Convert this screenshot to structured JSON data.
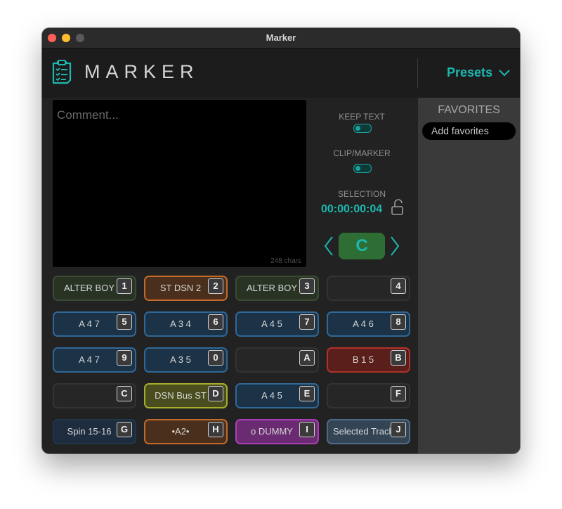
{
  "window": {
    "title": "Marker"
  },
  "header": {
    "logo_text": "MARKER",
    "presets_label": "Presets"
  },
  "comment": {
    "placeholder": "Comment...",
    "char_count": "248 chars"
  },
  "controls": {
    "keep_text_label": "KEEP TEXT",
    "clip_marker_label": "CLIP/MARKER",
    "selection_label": "SELECTION",
    "timecode": "00:00:00:04",
    "color_letter": "C"
  },
  "favorites": {
    "title": "FAVORITES",
    "placeholder": "Add favorites"
  },
  "markers": [
    {
      "label": "ALTER BOY",
      "key": "1",
      "bg": "#293324",
      "border": "#3b4a33"
    },
    {
      "label": "ST DSN 2",
      "key": "2",
      "bg": "#4a2f1c",
      "border": "#c2692b"
    },
    {
      "label": "ALTER BOY",
      "key": "3",
      "bg": "#293324",
      "border": "#3b4a33"
    },
    {
      "label": "",
      "key": "4",
      "bg": "#262626",
      "border": "#333333"
    },
    {
      "label": "A 4 7",
      "key": "5",
      "bg": "#1b3247",
      "border": "#2f6896"
    },
    {
      "label": "A 3 4",
      "key": "6",
      "bg": "#1b3247",
      "border": "#2f6896"
    },
    {
      "label": "A 4 5",
      "key": "7",
      "bg": "#1b3247",
      "border": "#2f6896"
    },
    {
      "label": "A 4 6",
      "key": "8",
      "bg": "#1b3247",
      "border": "#2f6896"
    },
    {
      "label": "A 4 7",
      "key": "9",
      "bg": "#1b3247",
      "border": "#2f6896"
    },
    {
      "label": "A 3 5",
      "key": "0",
      "bg": "#1b3247",
      "border": "#2f6896"
    },
    {
      "label": "",
      "key": "A",
      "bg": "#262626",
      "border": "#333333"
    },
    {
      "label": "B 1 5",
      "key": "B",
      "bg": "#5a1f1b",
      "border": "#b0322a"
    },
    {
      "label": "",
      "key": "C",
      "bg": "#262626",
      "border": "#333333"
    },
    {
      "label": "DSN Bus ST",
      "key": "D",
      "bg": "#4a4d1d",
      "border": "#a6ad2c"
    },
    {
      "label": "A 4 5",
      "key": "E",
      "bg": "#1b3247",
      "border": "#2f6896"
    },
    {
      "label": "",
      "key": "F",
      "bg": "#262626",
      "border": "#333333"
    },
    {
      "label": "Spin 15-16",
      "key": "G",
      "bg": "#1d2c3e",
      "border": "#233649"
    },
    {
      "label": "•A2•",
      "key": "H",
      "bg": "#4a2f1c",
      "border": "#c2692b"
    },
    {
      "label": "o DUMMY",
      "key": "I",
      "bg": "#6a2b72",
      "border": "#a83fb4"
    },
    {
      "label": "Selected Track",
      "key": "J",
      "bg": "#334455",
      "border": "#4d6b87"
    }
  ],
  "colors": {
    "accent": "#1bb8b0",
    "bg": "#222222",
    "sidebar": "#3a3a3a"
  }
}
